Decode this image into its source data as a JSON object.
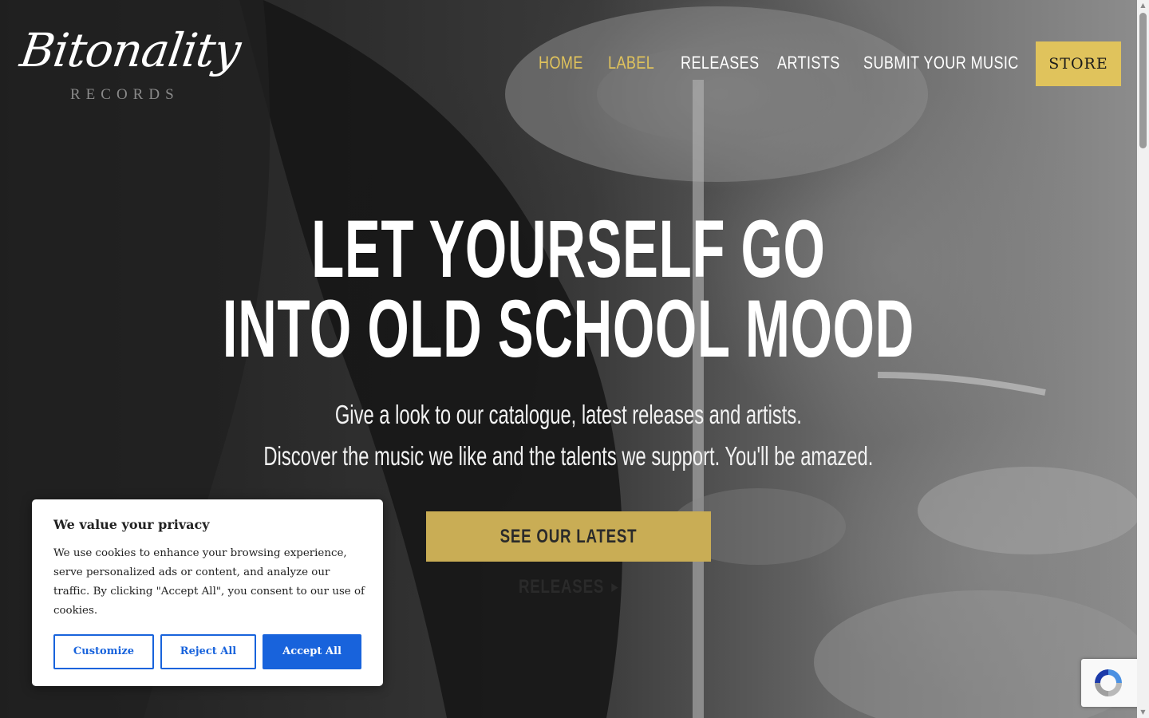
{
  "brand": {
    "logo_script": "Bitonality",
    "logo_sub": "RECORDS"
  },
  "nav": {
    "items": [
      {
        "label": "HOME",
        "active": true
      },
      {
        "label": "LABEL",
        "active": true
      },
      {
        "label": "RELEASES",
        "active": false
      },
      {
        "label": "ARTISTS",
        "active": false
      },
      {
        "label": "SUBMIT YOUR MUSIC",
        "active": false
      }
    ],
    "store_label": "STORE"
  },
  "hero": {
    "title_line1": "LET YOURSELF GO",
    "title_line2": "INTO OLD SCHOOL MOOD",
    "subtitle_line1": "Give a look to our catalogue, latest releases and artists.",
    "subtitle_line2": "Discover the music we like and the talents we support. You'll be amazed.",
    "cta_label": "SEE OUR LATEST RELEASES",
    "cta_icon": "play-triangle-icon"
  },
  "cookie_banner": {
    "title": "We value your privacy",
    "text": "We use cookies to enhance your browsing experience, serve personalized ads or content, and analyze our traffic. By clicking \"Accept All\", you consent to our use of cookies.",
    "customize_label": "Customize",
    "reject_label": "Reject All",
    "accept_label": "Accept All"
  },
  "colors": {
    "accent_gold": "#e0c35c",
    "cta_gold": "#c9ad55",
    "cookie_blue": "#1863dc",
    "white": "#ffffff"
  },
  "recaptcha": {
    "icon": "recaptcha-icon"
  }
}
